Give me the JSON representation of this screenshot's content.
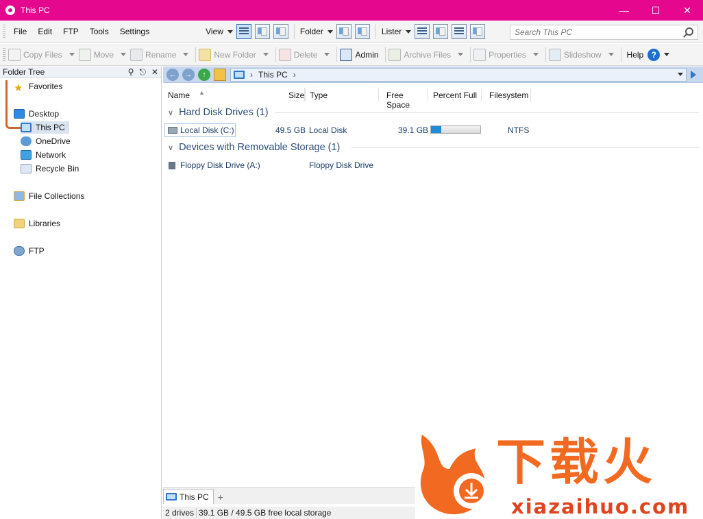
{
  "window": {
    "title": "This PC"
  },
  "menu": [
    "File",
    "Edit",
    "FTP",
    "Tools",
    "Settings"
  ],
  "toolbar": {
    "view": "View",
    "folder": "Folder",
    "lister": "Lister"
  },
  "search": {
    "placeholder": "Search This PC"
  },
  "actions": {
    "copy": "Copy Files",
    "move": "Move",
    "rename": "Rename",
    "new_folder": "New Folder",
    "delete": "Delete",
    "admin": "Admin",
    "archive": "Archive Files",
    "properties": "Properties",
    "slideshow": "Slideshow",
    "help": "Help",
    "help_icon": "?"
  },
  "tree": {
    "header": "Folder Tree",
    "items": [
      {
        "label": "Favorites",
        "icon": "star-icon"
      },
      {
        "label": "Desktop",
        "icon": "desktop-icon"
      },
      {
        "label": "This PC",
        "icon": "computer-icon"
      },
      {
        "label": "OneDrive",
        "icon": "onedrive-icon"
      },
      {
        "label": "Network",
        "icon": "network-icon"
      },
      {
        "label": "Recycle Bin",
        "icon": "recycle-bin-icon"
      },
      {
        "label": "File Collections",
        "icon": "collections-icon"
      },
      {
        "label": "Libraries",
        "icon": "libraries-icon"
      },
      {
        "label": "FTP",
        "icon": "ftp-icon"
      }
    ]
  },
  "path": {
    "segment": "This PC"
  },
  "columns": [
    "Name",
    "Size",
    "Type",
    "Free Space",
    "Percent Full",
    "Filesystem"
  ],
  "groups": [
    {
      "title": "Hard Disk Drives (1)",
      "rows": [
        {
          "name": "Local Disk (C:)",
          "size": "49.5 GB",
          "type": "Local Disk",
          "free": "39.1 GB",
          "percent_full": 0.21,
          "filesystem": "NTFS"
        }
      ]
    },
    {
      "title": "Devices with Removable Storage (1)",
      "rows": [
        {
          "name": "Floppy Disk Drive (A:)",
          "type": "Floppy Disk Drive"
        }
      ]
    }
  ],
  "tabs": {
    "active": "This PC",
    "add": "+"
  },
  "status": {
    "drives": "2 drives",
    "storage": "39.1 GB / 49.5 GB free local storage"
  },
  "watermark": {
    "cn": "下载火",
    "url": "xiazaihuo.com"
  },
  "colors": {
    "titlebar": "#e5088f",
    "accent": "#1f8ad6",
    "watermark": "#f26a21"
  }
}
